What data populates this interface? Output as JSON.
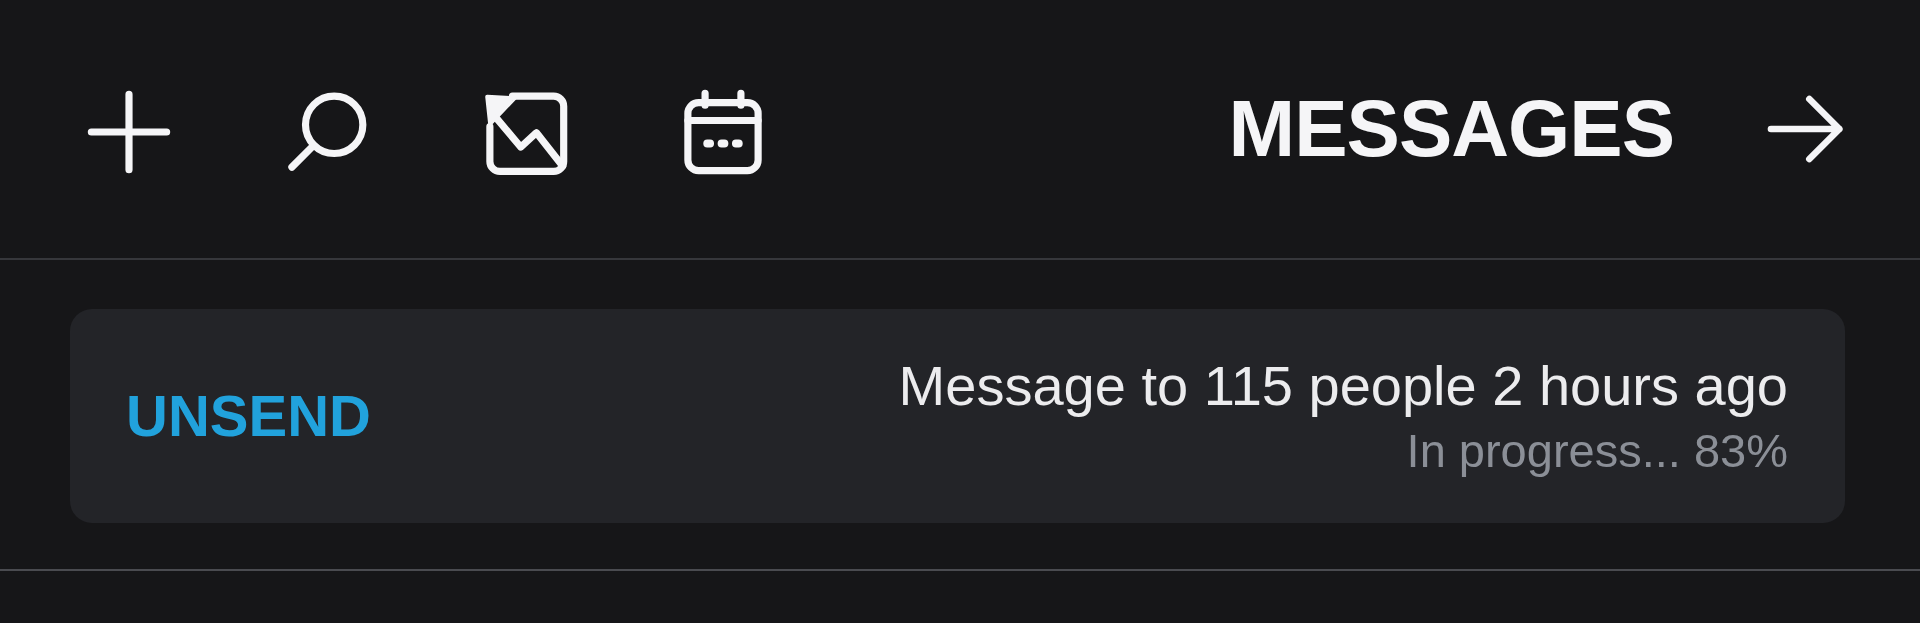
{
  "header": {
    "title": "MESSAGES"
  },
  "messages": [
    {
      "summary": "Message to 115 people 2 hours ago",
      "status": "In progress... 83%",
      "action": "UNSEND"
    }
  ]
}
